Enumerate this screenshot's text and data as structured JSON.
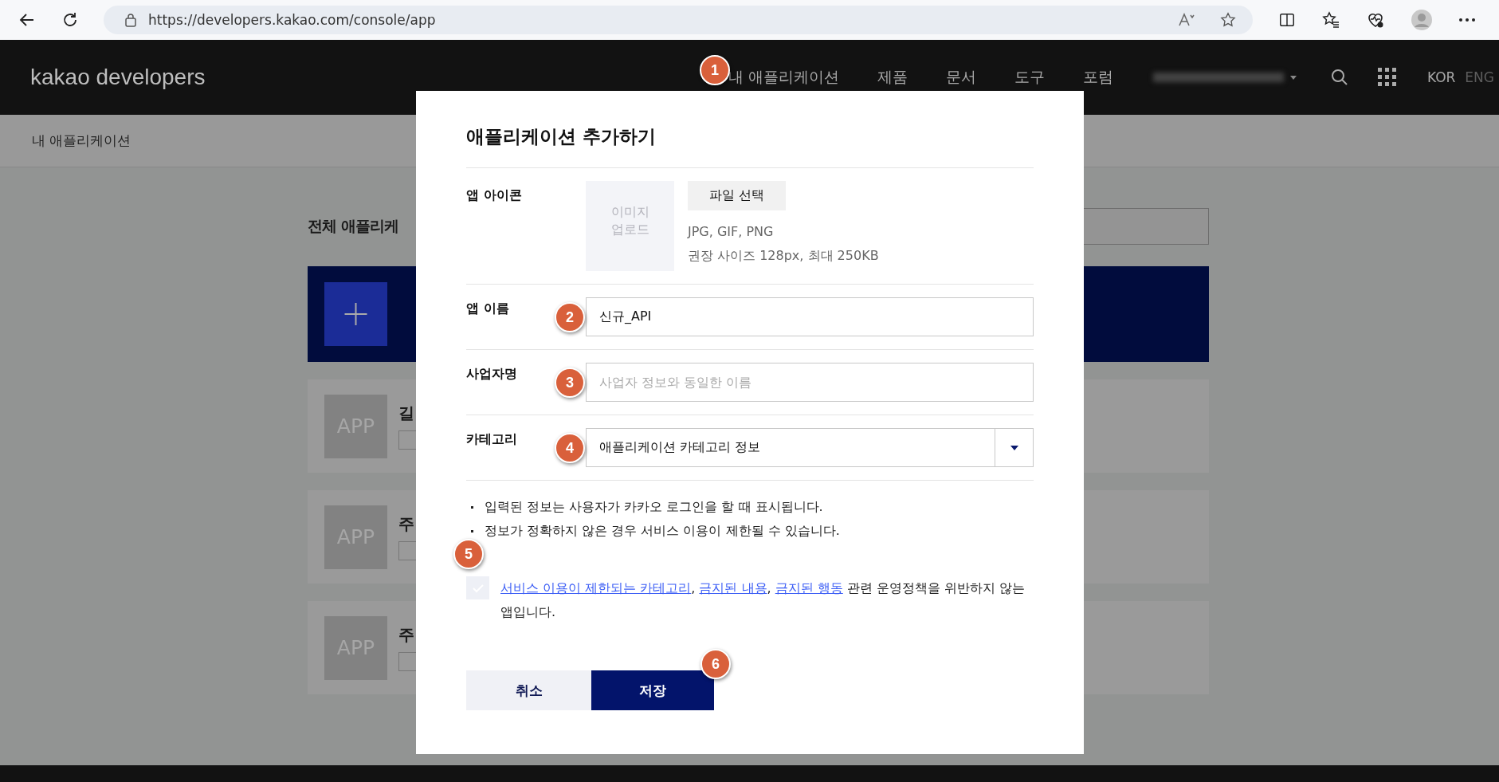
{
  "browser": {
    "url": "https://developers.kakao.com/console/app"
  },
  "header": {
    "logo": "kakao developers",
    "nav": [
      {
        "label": "내 애플리케이션",
        "marker": "1"
      },
      {
        "label": "제품"
      },
      {
        "label": "문서"
      },
      {
        "label": "도구"
      },
      {
        "label": "포럼"
      }
    ],
    "languages": [
      {
        "label": "KOR",
        "selected": true
      },
      {
        "label": "ENG",
        "selected": false
      }
    ]
  },
  "breadcrumb": "내 애플리케이션",
  "page": {
    "title": "전체 애플리케",
    "apps": [
      {
        "icon": "APP",
        "name": "길"
      },
      {
        "icon": "APP",
        "name": "주"
      },
      {
        "icon": "APP",
        "name": "주"
      }
    ]
  },
  "dialog": {
    "title": "애플리케이션 추가하기",
    "icon_field": {
      "label": "앱 아이콘",
      "upload_lines": [
        "이미지",
        "업로드"
      ],
      "button": "파일 선택",
      "notes": [
        "JPG, GIF, PNG",
        "권장 사이즈 128px, 최대 250KB"
      ]
    },
    "fields": [
      {
        "kind": "text",
        "label": "앱 이름",
        "value": "신규_API",
        "marker": "2"
      },
      {
        "kind": "text",
        "label": "사업자명",
        "placeholder": "사업자 정보와 동일한 이름",
        "marker": "3"
      },
      {
        "kind": "select",
        "label": "카테고리",
        "value": "애플리케이션 카테고리 정보",
        "marker": "4"
      }
    ],
    "notices": [
      "입력된 정보는 사용자가 카카오 로그인을 할 때 표시됩니다.",
      "정보가 정확하지 않은 경우 서비스 이용이 제한될 수 있습니다."
    ],
    "agreement": {
      "checked": false,
      "marker": "5",
      "parts": [
        {
          "kind": "link",
          "text": "서비스 이용이 제한되는 카테고리"
        },
        {
          "kind": "text",
          "text": ", "
        },
        {
          "kind": "link",
          "text": "금지된 내용"
        },
        {
          "kind": "text",
          "text": ", "
        },
        {
          "kind": "link",
          "text": "금지된 행동"
        },
        {
          "kind": "text",
          "text": " 관련 운영정책을 위반하지 않는 앱입니다."
        }
      ]
    },
    "buttons": [
      {
        "kind": "secondary",
        "label": "취소"
      },
      {
        "kind": "primary",
        "label": "저장",
        "marker": "6"
      }
    ]
  }
}
